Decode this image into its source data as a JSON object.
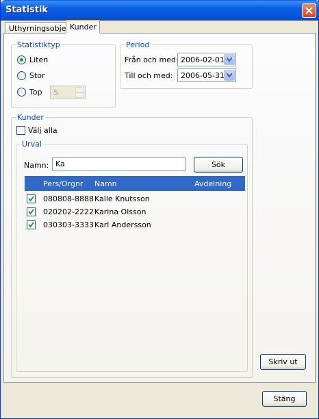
{
  "window": {
    "title": "Statistik"
  },
  "tabs": [
    {
      "label": "Uthyrningsobjekt"
    },
    {
      "label": "Kunder"
    }
  ],
  "statistiktyp": {
    "legend": "Statistiktyp",
    "options": [
      {
        "label": "Liten",
        "selected": true
      },
      {
        "label": "Stor",
        "selected": false
      },
      {
        "label": "Top",
        "selected": false
      }
    ],
    "top_value": "5"
  },
  "period": {
    "legend": "Period",
    "from_label": "Från och med:",
    "from_value": "2006-02-01",
    "to_label": "Till och med:",
    "to_value": "2006-05-31"
  },
  "kunder": {
    "legend": "Kunder",
    "select_all_label": "Välj alla",
    "select_all_checked": false,
    "urval": {
      "legend": "Urval",
      "name_label": "Namn:",
      "name_value": "Ka",
      "search_label": "Sök"
    },
    "columns": [
      "Pers/Orgnr",
      "Namn",
      "Avdelning"
    ],
    "rows": [
      {
        "checked": true,
        "id": "080808-8888",
        "name": "Kalle Knutsson",
        "dept": ""
      },
      {
        "checked": true,
        "id": "020202-2222",
        "name": "Karina Olsson",
        "dept": ""
      },
      {
        "checked": true,
        "id": "030303-3333",
        "name": "Karl Andersson",
        "dept": ""
      }
    ]
  },
  "buttons": {
    "print_label": "Skriv ut",
    "close_label": "Stäng"
  },
  "colors": {
    "accent": "#3169c6",
    "title_bar": "#0a5ee6",
    "group_legend": "#0046d5"
  }
}
